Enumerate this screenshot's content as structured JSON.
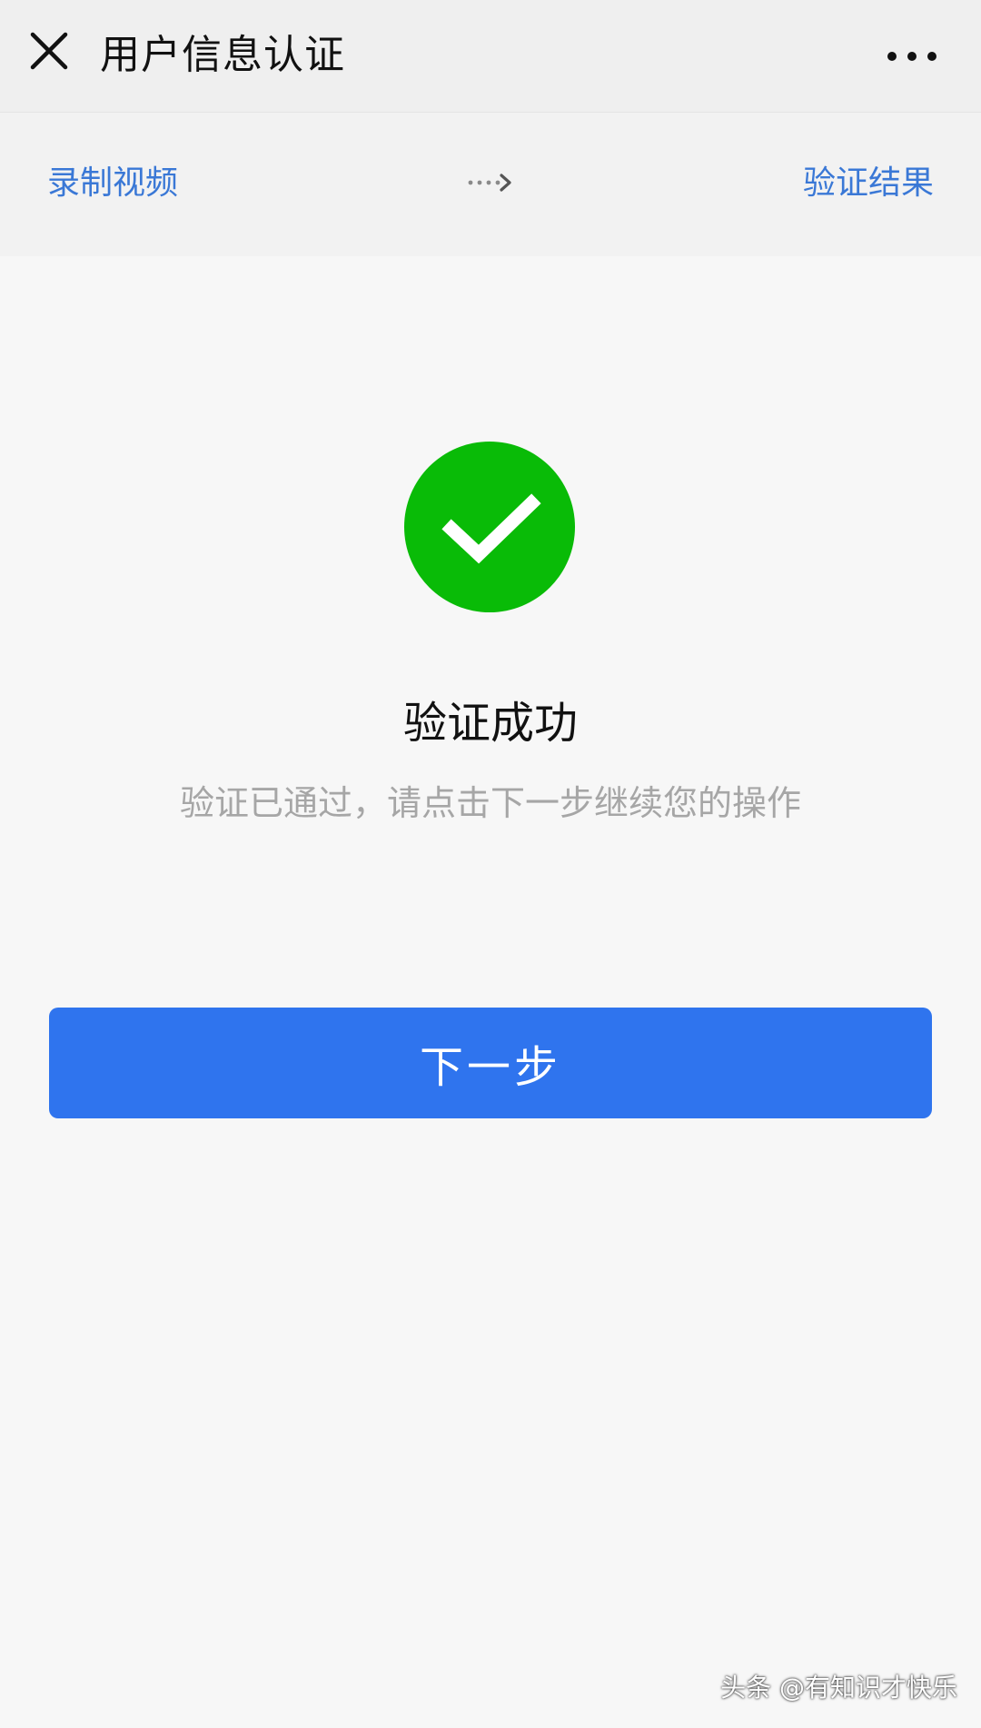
{
  "nav": {
    "title": "用户信息认证",
    "close_icon": "close-icon",
    "more_icon": "more-dots-icon"
  },
  "steps": [
    {
      "label": "录制视频"
    },
    {
      "label": "验证结果"
    }
  ],
  "result": {
    "icon": "check-circle-icon",
    "icon_color": "#09bb07",
    "title": "验证成功",
    "description": "验证已通过，请点击下一步继续您的操作"
  },
  "actions": {
    "next_label": "下一步",
    "next_color": "#2f74ee"
  },
  "watermark": {
    "text": "头条 @有知识才快乐"
  },
  "colors": {
    "link": "#3a78d6",
    "background": "#f7f7f7"
  }
}
